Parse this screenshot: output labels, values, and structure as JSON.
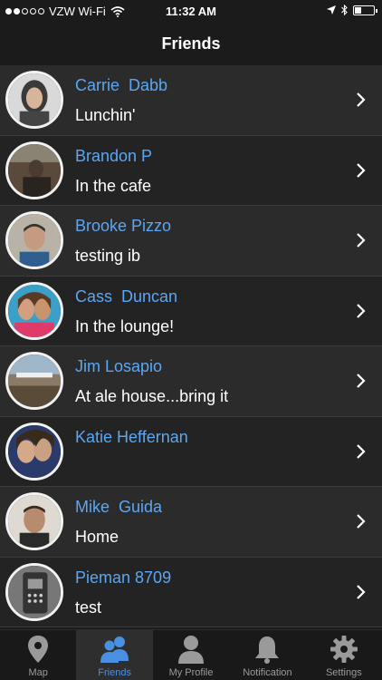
{
  "status_bar": {
    "carrier": "VZW Wi-Fi",
    "time": "11:32 AM",
    "battery_level": 0.35
  },
  "nav": {
    "title": "Friends"
  },
  "friends": [
    {
      "name": "Carrie  Dabb",
      "status": "Lunchin'"
    },
    {
      "name": "Brandon P",
      "status": "In the cafe"
    },
    {
      "name": "Brooke Pizzo",
      "status": "testing ib"
    },
    {
      "name": "Cass  Duncan",
      "status": "In the lounge!"
    },
    {
      "name": "Jim Losapio",
      "status": "At ale house...bring it"
    },
    {
      "name": "Katie Heffernan",
      "status": ""
    },
    {
      "name": "Mike  Guida",
      "status": "Home"
    },
    {
      "name": "Pieman 8709",
      "status": "test"
    }
  ],
  "tabs": [
    {
      "label": "Map",
      "icon": "map-pin-icon",
      "active": false
    },
    {
      "label": "Friends",
      "icon": "friends-icon",
      "active": true
    },
    {
      "label": "My Profile",
      "icon": "profile-icon",
      "active": false
    },
    {
      "label": "Notification",
      "icon": "bell-icon",
      "active": false
    },
    {
      "label": "Settings",
      "icon": "gear-icon",
      "active": false
    }
  ],
  "colors": {
    "accent": "#4a90e2",
    "name_blue": "#5aa7f5",
    "background": "#1b1b1b"
  }
}
